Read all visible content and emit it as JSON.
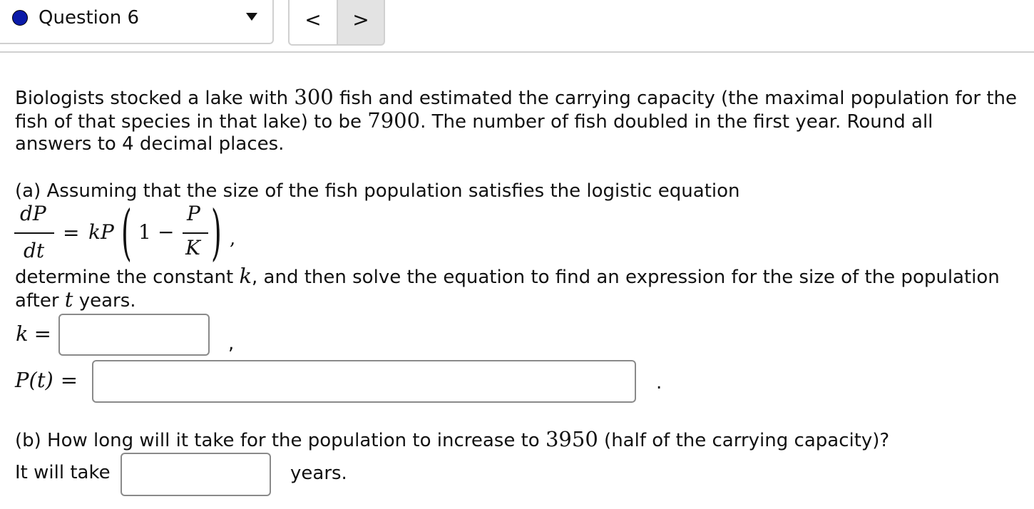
{
  "nav": {
    "question_label": "Question 6",
    "prev_label": "<",
    "next_label": ">",
    "question_dot_color": "#0a1aa8"
  },
  "problem": {
    "intro_1a": "Biologists stocked a lake with ",
    "initial_fish": "300",
    "intro_1b": " fish and estimated the carrying capacity (the maximal population for the",
    "intro_2a": "fish of that species in that lake) to be ",
    "carrying_capacity": "7900",
    "intro_2b": ". The number of fish doubled in the first year.  Round all",
    "intro_3": "answers to 4 decimal places."
  },
  "part_a": {
    "prompt": "(a) Assuming that the size of the fish population satisfies the logistic equation",
    "equation": {
      "lhs_num": "dP",
      "lhs_den": "dt",
      "equals": "=",
      "kP": "kP",
      "one": "1",
      "minus": "−",
      "rhs_num": "P",
      "rhs_den": "K",
      "trailing_comma": ","
    },
    "instruction_1a": "determine the constant ",
    "k_var": "k",
    "instruction_1b": ", and then solve the equation to find an expression for the size of the population",
    "instruction_2a": "after ",
    "t_var": "t",
    "instruction_2b": " years.",
    "k_label_var": "k",
    "k_label_eq": "=",
    "k_value": "",
    "k_suffix": ",",
    "p_label": "P(t)",
    "p_label_eq": "=",
    "p_value": "",
    "p_suffix": "."
  },
  "part_b": {
    "prompt_a": "(b) How long will it take for the population to increase to ",
    "half_capacity": "3950",
    "prompt_b": " (half of the carrying capacity)?",
    "answer_prefix": "It will take",
    "answer_value": "",
    "answer_suffix": "years."
  }
}
